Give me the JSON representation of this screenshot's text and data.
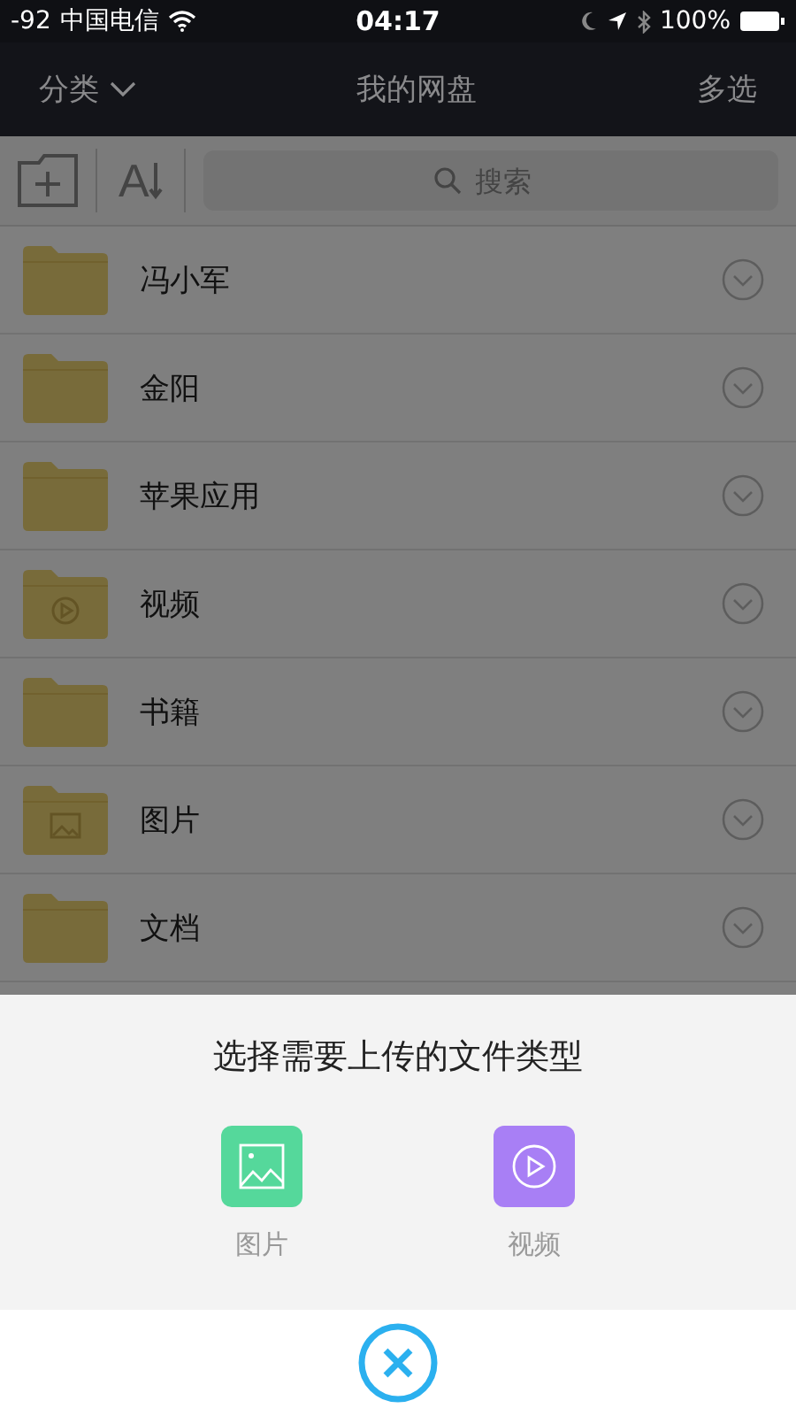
{
  "status_bar": {
    "signal": "-92",
    "carrier": "中国电信",
    "time": "04:17",
    "battery": "100%"
  },
  "nav": {
    "left": "分类",
    "title": "我的网盘",
    "right": "多选"
  },
  "toolbar": {
    "sort_label": "A",
    "search_placeholder": "搜索"
  },
  "folders": [
    {
      "name": "冯小军",
      "kind": "plain"
    },
    {
      "name": "金阳",
      "kind": "plain"
    },
    {
      "name": "苹果应用",
      "kind": "plain"
    },
    {
      "name": "视频",
      "kind": "video"
    },
    {
      "name": "书籍",
      "kind": "plain"
    },
    {
      "name": "图片",
      "kind": "image"
    },
    {
      "name": "文档",
      "kind": "plain"
    }
  ],
  "upload_sheet": {
    "title": "选择需要上传的文件类型",
    "options": [
      {
        "label": "图片",
        "kind": "image",
        "color": "#55d89b"
      },
      {
        "label": "视频",
        "kind": "video",
        "color": "#a87ff5"
      }
    ]
  }
}
